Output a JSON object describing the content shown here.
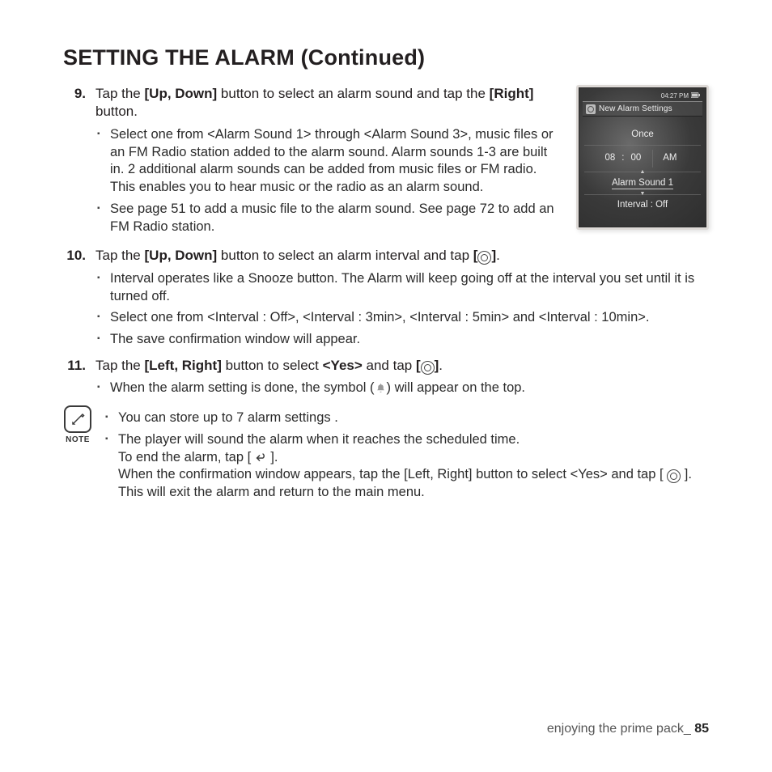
{
  "title": "SETTING THE ALARM (Continued)",
  "steps": {
    "s9": {
      "num": "9.",
      "lead_a": "Tap the ",
      "lead_b": "[Up, Down]",
      "lead_c": " button to select an alarm sound and tap the ",
      "lead_d": "[Right]",
      "lead_e": " button.",
      "bullets": [
        "Select one from <Alarm Sound 1> through <Alarm Sound 3>, music files or an FM Radio station added to the alarm sound. Alarm sounds 1-3 are built in. 2 additional alarm sounds can be added from music files or FM radio. This enables you to hear music or the radio as an alarm sound.",
        "See page 51 to add a music file to the alarm sound. See page 72 to add an FM Radio station."
      ]
    },
    "s10": {
      "num": "10.",
      "lead_a": "Tap the ",
      "lead_b": "[Up, Down]",
      "lead_c": " button to select an alarm interval and tap ",
      "lead_d": "[",
      "lead_e": "]",
      "lead_f": ".",
      "bullets": [
        "Interval operates like a Snooze button. The Alarm will keep going off at the interval you set until it is turned off.",
        "Select one from <Interval : Off>, <Interval : 3min>, <Interval : 5min> and <Interval : 10min>.",
        "The save confirmation window will appear."
      ]
    },
    "s11": {
      "num": "11.",
      "lead_a": "Tap the ",
      "lead_b": "[Left, Right]",
      "lead_c": " button to select ",
      "lead_d": "<Yes>",
      "lead_e": " and tap ",
      "lead_f": "[",
      "lead_g": "]",
      "lead_h": ".",
      "bullet_a": "When the alarm setting is done, the symbol (",
      "bullet_b": ") will appear on the top."
    }
  },
  "notes": {
    "label": "NOTE",
    "n1": "You can store up to 7 alarm settings .",
    "n2a": "The player will sound the alarm when it reaches the scheduled time.",
    "n2b_a": "To end the alarm, tap [ ",
    "n2b_b": " ].",
    "n2c": "When the confirmation window appears, tap the [Left, Right] button to select <Yes> and tap [ ",
    "n2c_b": " ]. This will exit the alarm and return to the main menu."
  },
  "device": {
    "time": "04:27 PM",
    "title": "New Alarm Settings",
    "repeat": "Once",
    "hour": "08",
    "min": "00",
    "ampm": "AM",
    "sound": "Alarm Sound 1",
    "interval": "Interval : Off"
  },
  "footer": {
    "section": "enjoying the prime pack_",
    "page": "85"
  }
}
